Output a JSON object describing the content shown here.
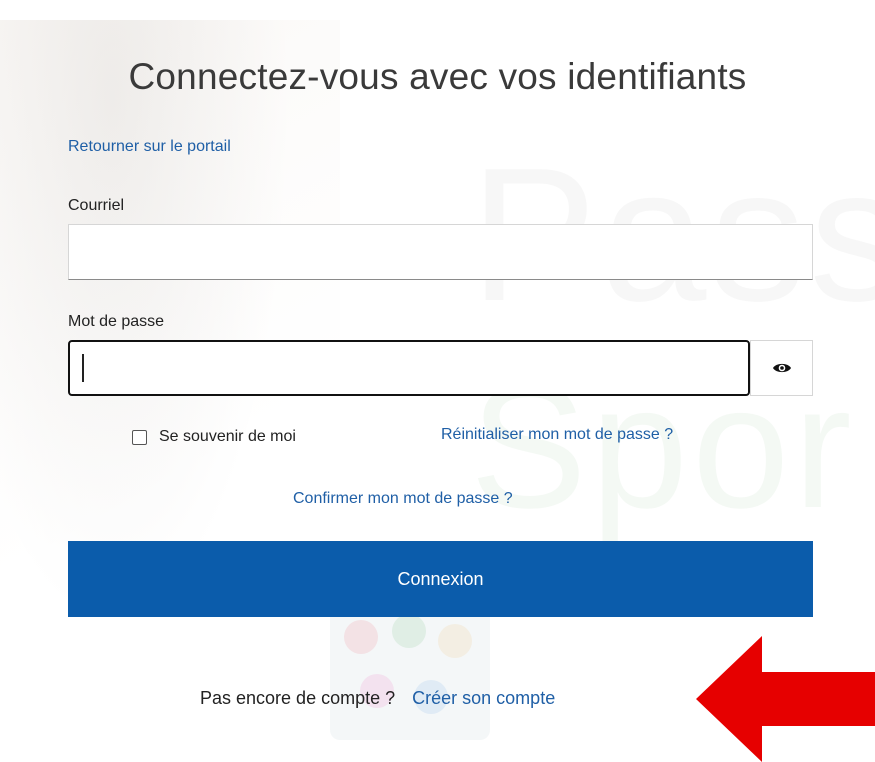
{
  "page": {
    "title": "Connectez-vous avec vos identifiants",
    "portal_link": "Retourner sur le portail"
  },
  "background": {
    "word_top": "Pass",
    "word_bottom": "Spor"
  },
  "form": {
    "email_label": "Courriel",
    "email_value": "",
    "password_label": "Mot de passe",
    "password_value": "",
    "show_password_icon": "eye-icon",
    "remember_label": "Se souvenir de moi",
    "remember_checked": false,
    "reset_link": "Réinitialiser mon mot de passe ?",
    "confirm_link": "Confirmer mon mot de passe ?",
    "submit_label": "Connexion"
  },
  "signup": {
    "prompt": "Pas encore de compte ?",
    "link": "Créer son compte"
  },
  "colors": {
    "primary": "#0b5cab",
    "link": "#1f5fa6",
    "annotation_arrow": "#e60000"
  }
}
